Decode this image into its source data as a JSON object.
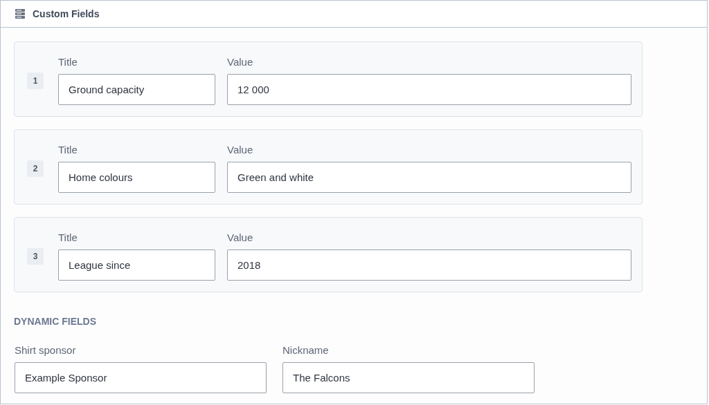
{
  "header": {
    "title": "Custom Fields"
  },
  "custom_fields": [
    {
      "number": "1",
      "title_label": "Title",
      "title": "Ground capacity",
      "value_label": "Value",
      "value": "12 000"
    },
    {
      "number": "2",
      "title_label": "Title",
      "title": "Home colours",
      "value_label": "Value",
      "value": "Green and white"
    },
    {
      "number": "3",
      "title_label": "Title",
      "title": "League since",
      "value_label": "Value",
      "value": "2018"
    }
  ],
  "dynamic_fields": {
    "heading": "DYNAMIC FIELDS",
    "fields": [
      {
        "label": "Shirt sponsor",
        "value": "Example Sponsor"
      },
      {
        "label": "Nickname",
        "value": "The Falcons"
      }
    ]
  }
}
